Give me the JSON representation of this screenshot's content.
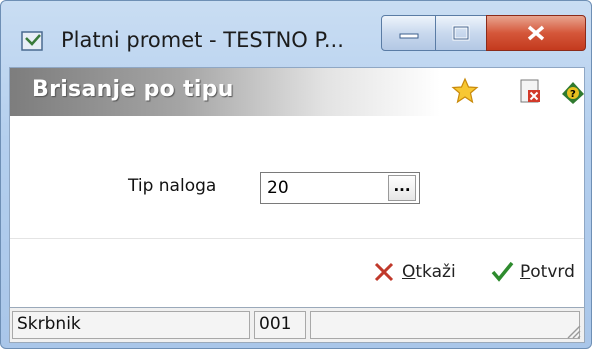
{
  "window": {
    "title": "Platni promet - TESTNO P..."
  },
  "panel": {
    "title": "Brisanje po tipu"
  },
  "icons": {
    "app": "app-document-icon",
    "favorite": "star-icon",
    "delete": "delete-document-icon",
    "help": "help-icon",
    "cancel": "cancel-x-icon",
    "confirm": "checkmark-icon"
  },
  "form": {
    "label": "Tip naloga",
    "value": "20",
    "lookup": "..."
  },
  "actions": {
    "cancel_hot": "O",
    "cancel_rest": "tkaži",
    "confirm_hot": "P",
    "confirm_rest": "otvrd"
  },
  "status": {
    "user": "Skrbnik",
    "code": "001",
    "info": ""
  },
  "colors": {
    "close": "#c43a1e",
    "cancel": "#c0392b",
    "confirm": "#2e8b2e"
  }
}
